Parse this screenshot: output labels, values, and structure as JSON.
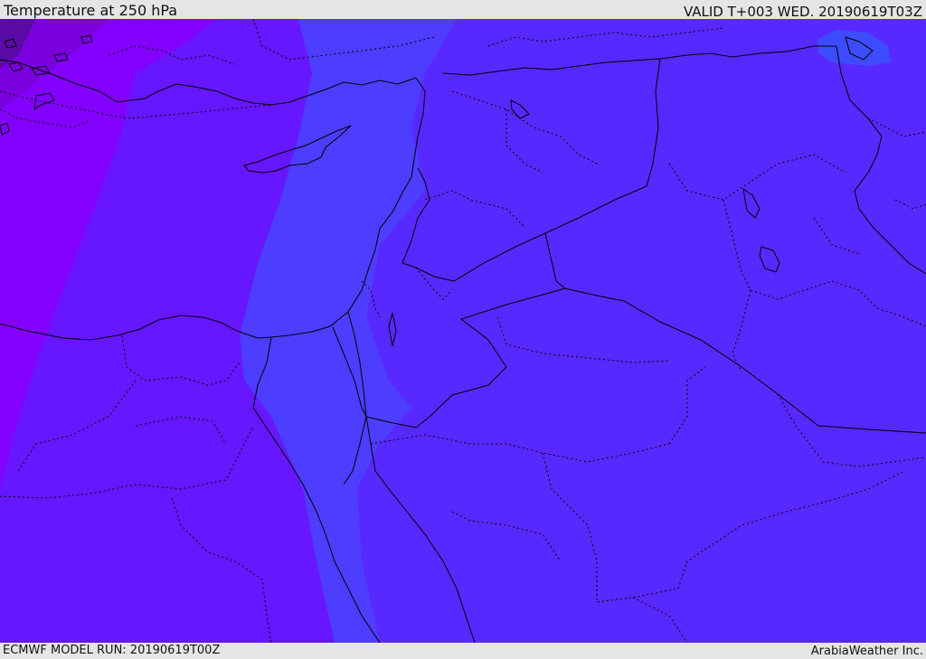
{
  "header": {
    "title": "Temperature at 250 hPa",
    "valid_time": "VALID T+003 WED. 20190619T03Z"
  },
  "footer": {
    "model_run": "ECMWF MODEL RUN: 20190619T00Z",
    "credit": "ArabiaWeather Inc."
  },
  "colors": {
    "temp_band_warmest": "#5829ff",
    "temp_band_warm": "#4d3dff",
    "temp_band_mid": "#6617ff",
    "temp_band_cool": "#8300ff",
    "temp_band_cold": "#7a00dd",
    "temp_band_coldest": "#5a0aa6",
    "northeast_spot": "#3d4cff",
    "coastline": "#000000",
    "border": "#000000"
  }
}
